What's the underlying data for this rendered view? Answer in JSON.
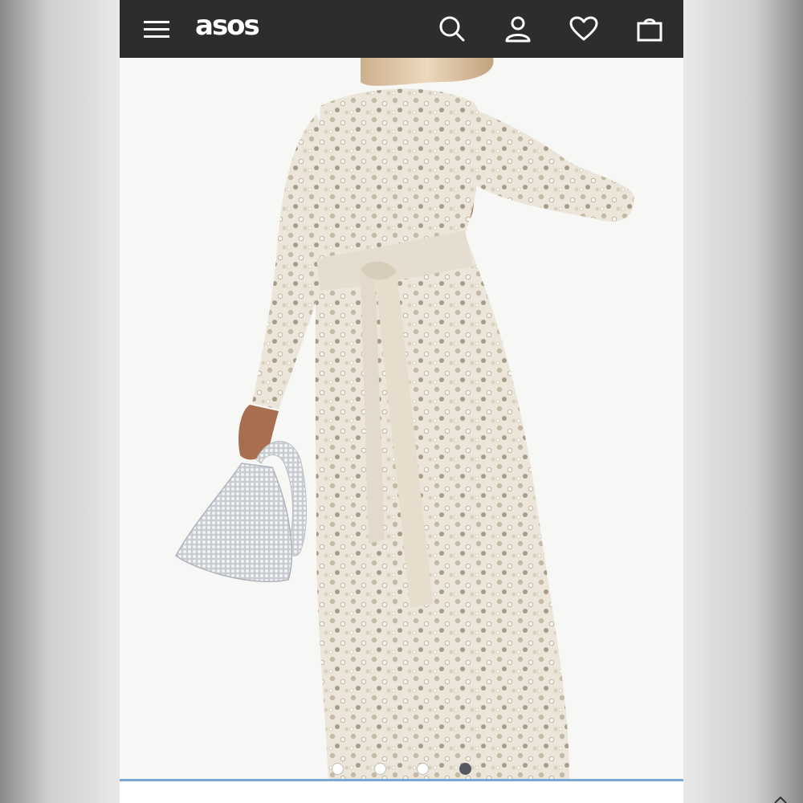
{
  "header": {
    "logo_text": "asos",
    "icons": [
      "menu-icon",
      "search-icon",
      "account-icon",
      "heart-icon",
      "bag-icon"
    ]
  },
  "product_gallery": {
    "image_subject": "sequin-maxi-dress",
    "total_images": 4,
    "active_index": 4
  },
  "colors": {
    "header_bg": "#2d2d2d",
    "dress": "#e9e2d6",
    "sequin": "#b9ae9a",
    "active_dot": "#555a60",
    "bottom_accent": "#7aa6d8"
  }
}
